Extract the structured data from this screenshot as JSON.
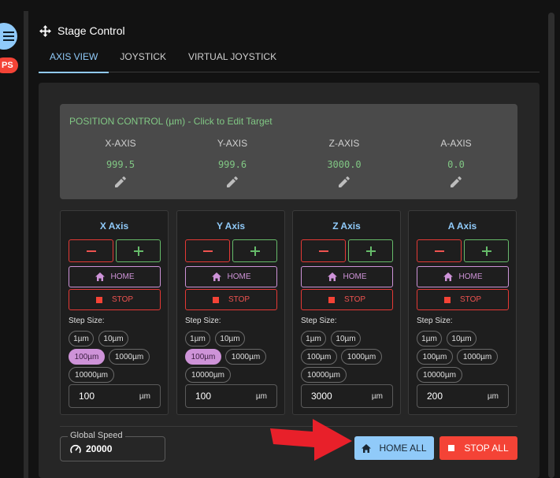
{
  "sidebar": {
    "badge": "PS",
    "menu_icon": "menu-icon"
  },
  "header": {
    "title": "Stage Control",
    "icon": "move-icon"
  },
  "tabs": [
    {
      "label": "AXIS VIEW",
      "active": true
    },
    {
      "label": "JOYSTICK",
      "active": false
    },
    {
      "label": "VIRTUAL JOYSTICK",
      "active": false
    }
  ],
  "position": {
    "title": "POSITION CONTROL (µm) - Click to Edit Target",
    "axes": [
      {
        "label": "X-AXIS",
        "value": "999.5"
      },
      {
        "label": "Y-AXIS",
        "value": "999.6"
      },
      {
        "label": "Z-AXIS",
        "value": "3000.0"
      },
      {
        "label": "A-AXIS",
        "value": "0.0"
      }
    ]
  },
  "axes": [
    {
      "title": "X Axis",
      "home": "HOME",
      "stop": "STOP",
      "step_label": "Step Size:",
      "steps": [
        "1µm",
        "10µm",
        "100µm",
        "1000µm",
        "10000µm"
      ],
      "selected": 2,
      "step_value": "100",
      "unit": "µm"
    },
    {
      "title": "Y Axis",
      "home": "HOME",
      "stop": "STOP",
      "step_label": "Step Size:",
      "steps": [
        "1µm",
        "10µm",
        "100µm",
        "1000µm",
        "10000µm"
      ],
      "selected": 2,
      "step_value": "100",
      "unit": "µm"
    },
    {
      "title": "Z Axis",
      "home": "HOME",
      "stop": "STOP",
      "step_label": "Step Size:",
      "steps": [
        "1µm",
        "10µm",
        "100µm",
        "1000µm",
        "10000µm"
      ],
      "selected": -1,
      "step_value": "3000",
      "unit": "µm"
    },
    {
      "title": "A Axis",
      "home": "HOME",
      "stop": "STOP",
      "step_label": "Step Size:",
      "steps": [
        "1µm",
        "10µm",
        "100µm",
        "1000µm",
        "10000µm"
      ],
      "selected": -1,
      "step_value": "200",
      "unit": "µm"
    }
  ],
  "global_speed": {
    "label": "Global Speed",
    "value": "20000"
  },
  "actions": {
    "home_all": "HOME ALL",
    "stop_all": "STOP ALL"
  },
  "colors": {
    "accent": "#90caf9",
    "danger": "#f44336",
    "success": "#66bb6a",
    "home": "#ce93d8"
  }
}
